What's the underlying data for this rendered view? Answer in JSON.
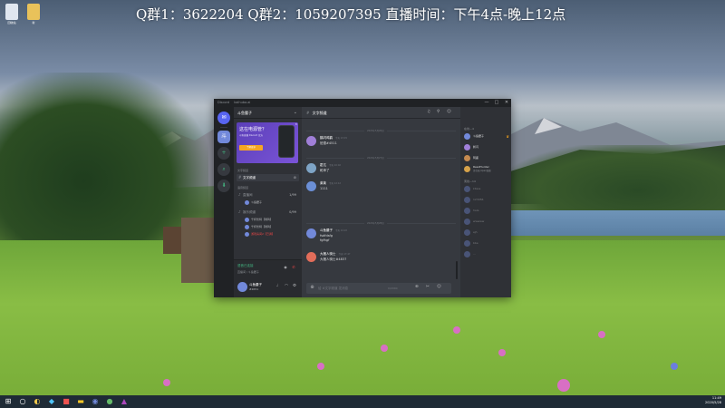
{
  "banner": {
    "text": "Q群1：3622204 Q群2：1059207395  直播时间：下午4点-晚上12点"
  },
  "desktop": {
    "icons": [
      {
        "name": "recycle-bin",
        "label": "回收站"
      },
      {
        "name": "folder",
        "label": "新"
      }
    ]
  },
  "window": {
    "title": "Discord",
    "subtitle": "kaihuba.ai",
    "controls": [
      "—",
      "□",
      "✕"
    ]
  },
  "rail": {
    "servers": [
      "✉",
      "斗",
      "+",
      "⌕",
      "⬇"
    ]
  },
  "channels": {
    "server_name": "斗鱼腰子",
    "promo": {
      "title": "这在电源管？",
      "subtitle": "斗鱼直播 Discord 官方",
      "button": "了解更多"
    },
    "category_text": "文字频道",
    "text_channel": "文字频道",
    "category_voice": "语音频道",
    "voice_items": [
      {
        "name": "直播间",
        "count": "1/99"
      },
      {
        "name": "娱乐频道",
        "count": "0/99"
      }
    ],
    "voice_users": [
      {
        "name": "斗鱼腰子"
      },
      {
        "name": "千杯伏特【骑鸡】"
      },
      {
        "name": "千杯伏特【骑鸡】"
      },
      {
        "name": "游戏房间2【已满】"
      }
    ],
    "voice_connected": "语音已连接",
    "voice_channel": "直播间 / 斗鱼腰子",
    "user": {
      "name": "斗鱼腰子",
      "tag": "#2651"
    }
  },
  "chat": {
    "channel": "文字频道",
    "messages": [
      {
        "divider": "2020年5月26日",
        "author": "鹤闪鸡鹤",
        "time": "今天 13:15",
        "body": "班德#4511",
        "color": "#a07fd8"
      },
      {
        "divider": "2020年5月27日",
        "author": "霍达",
        "time": "今天 10:02",
        "body": "乾坤了",
        "color": "#7ea4c6"
      },
      {
        "divider": "",
        "author": "莱莱",
        "time": "今天 12:12",
        "body": "1111",
        "color": "#6b8fd6"
      },
      {
        "divider": "2020年5月28日",
        "author": "斗鱼腰子",
        "time": "今天 14:22",
        "body": "fsdfdsfg",
        "body2": "fgfhgf",
        "color": "#7289da"
      },
      {
        "divider": "",
        "author": "大猪人骑士",
        "time": "今天 17:47",
        "body": "大猪人骑士#4837",
        "color": "#e26d5a"
      }
    ],
    "composer": {
      "placeholder": "给 #文字频道 发消息",
      "counter": "0/2000"
    }
  },
  "members": {
    "online_title": "在线—4",
    "offline_title": "离线—14",
    "online": [
      {
        "name": "斗鱼腰子",
        "sub": "",
        "color": "#7289da",
        "owner": true
      },
      {
        "name": "鹤闪",
        "sub": "",
        "color": "#a07fd8",
        "owner": false
      },
      {
        "name": "阿鹿",
        "sub": "",
        "color": "#c58a4f",
        "owner": false
      },
      {
        "name": "ReadHunter",
        "sub": "正在玩 Apex英雄",
        "color": "#d6a24a",
        "owner": false
      }
    ],
    "offline": [
      {
        "name": "kbsss",
        "color": "#7289da"
      },
      {
        "name": "123456",
        "color": "#7289da"
      },
      {
        "name": "hala",
        "color": "#7289da"
      },
      {
        "name": "wwwww",
        "color": "#7289da"
      },
      {
        "name": "ejh",
        "color": "#7289da"
      },
      {
        "name": "bbe",
        "color": "#7289da"
      },
      {
        "name": "...",
        "color": "#7289da"
      }
    ]
  },
  "taskbar": {
    "time": "11:49",
    "date": "2020/5/28"
  }
}
